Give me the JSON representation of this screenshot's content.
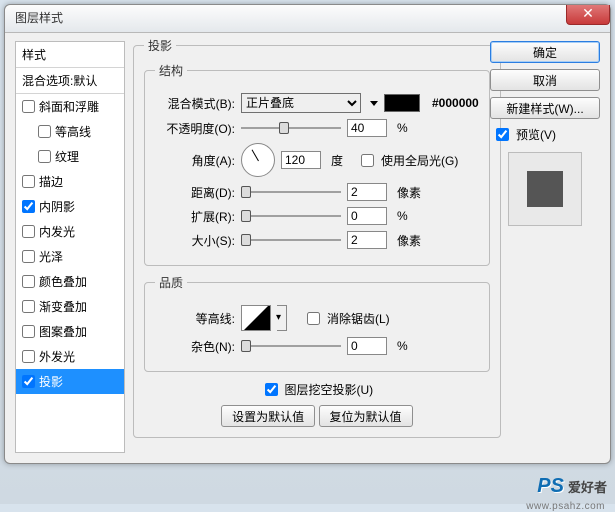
{
  "dialog": {
    "title": "图层样式"
  },
  "left": {
    "head": "样式",
    "sub": "混合选项:默认",
    "items": [
      {
        "label": "斜面和浮雕",
        "checked": false,
        "child": false
      },
      {
        "label": "等高线",
        "checked": false,
        "child": true
      },
      {
        "label": "纹理",
        "checked": false,
        "child": true
      },
      {
        "label": "描边",
        "checked": false,
        "child": false
      },
      {
        "label": "内阴影",
        "checked": true,
        "child": false
      },
      {
        "label": "内发光",
        "checked": false,
        "child": false
      },
      {
        "label": "光泽",
        "checked": false,
        "child": false
      },
      {
        "label": "颜色叠加",
        "checked": false,
        "child": false
      },
      {
        "label": "渐变叠加",
        "checked": false,
        "child": false
      },
      {
        "label": "图案叠加",
        "checked": false,
        "child": false
      },
      {
        "label": "外发光",
        "checked": false,
        "child": false
      },
      {
        "label": "投影",
        "checked": true,
        "child": false,
        "selected": true
      }
    ]
  },
  "main": {
    "section_title": "投影",
    "structure_legend": "结构",
    "blend_label": "混合模式(B):",
    "blend_value": "正片叠底",
    "color_hex": "#000000",
    "opacity_label": "不透明度(O):",
    "opacity_value": "40",
    "angle_label": "角度(A):",
    "angle_value": "120",
    "angle_unit": "度",
    "global_light_label": "使用全局光(G)",
    "global_light_checked": false,
    "distance_label": "距离(D):",
    "distance_value": "2",
    "distance_unit": "像素",
    "spread_label": "扩展(R):",
    "spread_value": "0",
    "size_label": "大小(S):",
    "size_value": "2",
    "size_unit": "像素",
    "quality_legend": "品质",
    "contour_label": "等高线:",
    "antialias_label": "消除锯齿(L)",
    "noise_label": "杂色(N):",
    "noise_value": "0",
    "percent": "%",
    "knockout_label": "图层挖空投影(U)",
    "knockout_checked": true,
    "default_btn": "设置为默认值",
    "reset_btn": "复位为默认值"
  },
  "right": {
    "ok": "确定",
    "cancel": "取消",
    "newstyle": "新建样式(W)...",
    "preview_label": "预览(V)",
    "preview_checked": true
  },
  "watermark": {
    "logo": "PS",
    "text": "爱好者",
    "url": "www.psahz.com"
  }
}
